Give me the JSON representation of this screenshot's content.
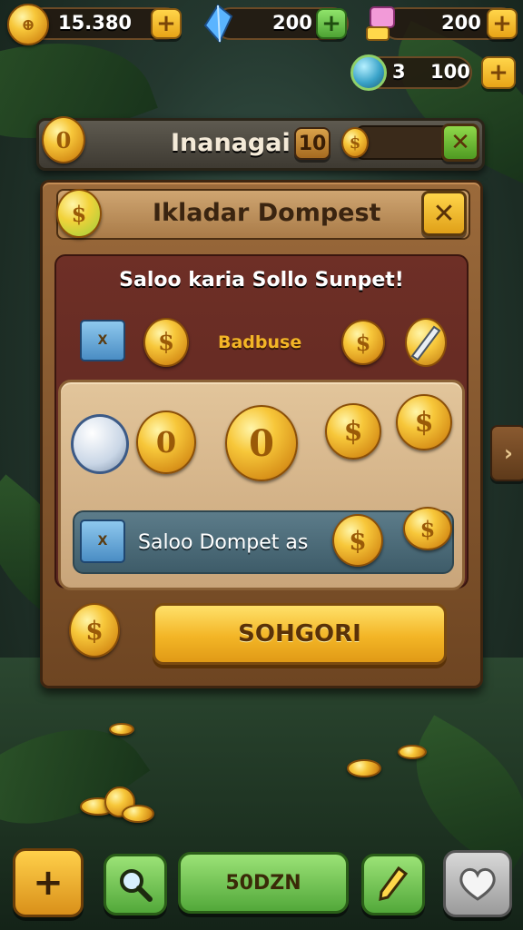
{
  "top_bar": {
    "coins_value": "15.380",
    "gems_value": "200",
    "blocks_value": "200",
    "orbs_count": "3",
    "orbs_value": "100",
    "plus_symbol": "+"
  },
  "header_bar": {
    "coin_glyph": "0",
    "title": "Inanagai",
    "count": "10",
    "coin_symbol": "$",
    "close_symbol": "✕"
  },
  "dialog": {
    "title": "Ikladar Dompest",
    "coin_symbol": "$",
    "close_symbol": "✕",
    "subtitle": "Saloo karia Sollo Sunpet!",
    "badge_label": "Badbuse",
    "chest_mark": "X",
    "reward_coin_glyph": "0",
    "info_label": "Saloo Dompet as",
    "confirm_label": "SOHGORI"
  },
  "bottom_nav": {
    "center_label": "50DZN",
    "plus_symbol": "+"
  },
  "colors": {
    "gold": "#f3b526",
    "wood": "#6e4522",
    "green": "#52a83a",
    "panel_red": "#5b2620"
  },
  "icons": [
    "coin-icon",
    "gem-icon",
    "block-icon",
    "orb-icon",
    "chest-icon",
    "magnifier-icon",
    "pencil-icon",
    "heart-icon",
    "plus-icon",
    "close-icon"
  ]
}
